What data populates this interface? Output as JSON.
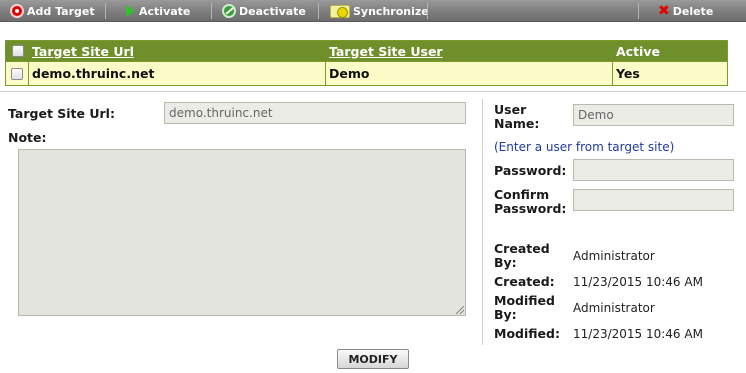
{
  "toolbar": {
    "add_target": "Add Target",
    "activate": "Activate",
    "deactivate": "Deactivate",
    "synchronize": "Synchronize",
    "delete": "Delete"
  },
  "grid": {
    "columns": [
      "Target Site Url",
      "Target Site User",
      "Active"
    ],
    "rows": [
      {
        "url": "demo.thruinc.net",
        "user": "Demo",
        "active": "Yes"
      }
    ]
  },
  "form": {
    "target_site_url_label": "Target Site Url:",
    "target_site_url_value": "demo.thruinc.net",
    "note_label": "Note:",
    "user_name_label_1": "User",
    "user_name_label_2": "Name:",
    "user_name_value": "Demo",
    "user_hint": "(Enter a user from target site)",
    "password_label": "Password:",
    "confirm_label_1": "Confirm",
    "confirm_label_2": "Password:",
    "created_by_label_1": "Created",
    "created_by_label_2": "By:",
    "created_by_value": "Administrator",
    "created_label": "Created:",
    "created_value": "11/23/2015 10:46 AM",
    "modified_by_label_1": "Modified",
    "modified_by_label_2": "By:",
    "modified_by_value": "Administrator",
    "modified_label": "Modified:",
    "modified_value": "11/23/2015 10:46 AM",
    "modify_button": "MODIFY"
  },
  "colors": {
    "toolbar": "#7d7d7d",
    "grid_header": "#6f8f2a",
    "grid_row": "#fbfbc8",
    "hint_link": "#1f3aa0"
  }
}
